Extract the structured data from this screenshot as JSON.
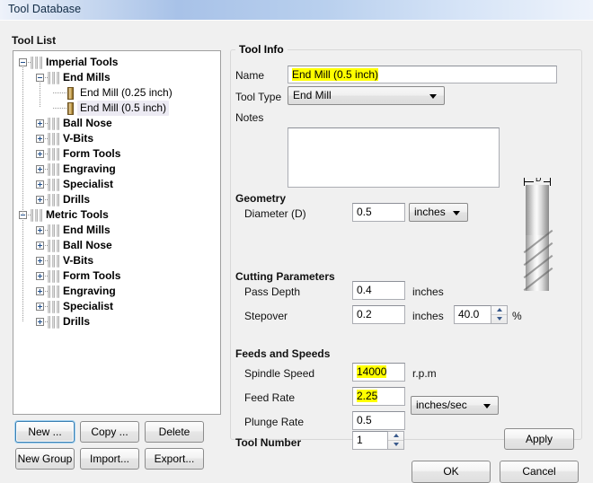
{
  "window": {
    "title": "Tool Database"
  },
  "tool_list": {
    "heading": "Tool List",
    "tree": [
      {
        "label": "Imperial Tools",
        "depth": 0,
        "bold": true,
        "state": "expanded",
        "icon": "tool-group-icon"
      },
      {
        "label": "End Mills",
        "depth": 1,
        "bold": true,
        "state": "expanded",
        "icon": "tool-group-icon"
      },
      {
        "label": "End Mill (0.25 inch)",
        "depth": 2,
        "bold": false,
        "state": "leaf",
        "icon": "end-mill-icon"
      },
      {
        "label": "End Mill (0.5 inch)",
        "depth": 2,
        "bold": false,
        "state": "leaf",
        "icon": "end-mill-icon",
        "selected": true
      },
      {
        "label": "Ball Nose",
        "depth": 1,
        "bold": true,
        "state": "collapsed",
        "icon": "tool-group-icon"
      },
      {
        "label": "V-Bits",
        "depth": 1,
        "bold": true,
        "state": "collapsed",
        "icon": "tool-group-icon"
      },
      {
        "label": "Form Tools",
        "depth": 1,
        "bold": true,
        "state": "collapsed",
        "icon": "tool-group-icon"
      },
      {
        "label": "Engraving",
        "depth": 1,
        "bold": true,
        "state": "collapsed",
        "icon": "tool-group-icon"
      },
      {
        "label": "Specialist",
        "depth": 1,
        "bold": true,
        "state": "collapsed",
        "icon": "tool-group-icon"
      },
      {
        "label": "Drills",
        "depth": 1,
        "bold": true,
        "state": "collapsed",
        "icon": "tool-group-icon"
      },
      {
        "label": "Metric Tools",
        "depth": 0,
        "bold": true,
        "state": "expanded",
        "icon": "tool-group-icon"
      },
      {
        "label": "End Mills",
        "depth": 1,
        "bold": true,
        "state": "collapsed",
        "icon": "tool-group-icon"
      },
      {
        "label": "Ball Nose",
        "depth": 1,
        "bold": true,
        "state": "collapsed",
        "icon": "tool-group-icon"
      },
      {
        "label": "V-Bits",
        "depth": 1,
        "bold": true,
        "state": "collapsed",
        "icon": "tool-group-icon"
      },
      {
        "label": "Form Tools",
        "depth": 1,
        "bold": true,
        "state": "collapsed",
        "icon": "tool-group-icon"
      },
      {
        "label": "Engraving",
        "depth": 1,
        "bold": true,
        "state": "collapsed",
        "icon": "tool-group-icon"
      },
      {
        "label": "Specialist",
        "depth": 1,
        "bold": true,
        "state": "collapsed",
        "icon": "tool-group-icon"
      },
      {
        "label": "Drills",
        "depth": 1,
        "bold": true,
        "state": "collapsed",
        "icon": "tool-group-icon"
      }
    ],
    "buttons": {
      "new": "New ...",
      "copy": "Copy ...",
      "delete": "Delete",
      "new_group": "New Group",
      "import": "Import...",
      "export": "Export..."
    }
  },
  "tool_info": {
    "group_title": "Tool Info",
    "name_label": "Name",
    "name_value": "End Mill (0.5 inch)",
    "tool_type_label": "Tool Type",
    "tool_type_value": "End Mill",
    "notes_label": "Notes",
    "notes_value": "",
    "geometry": {
      "title": "Geometry",
      "diameter_label": "Diameter (D)",
      "diameter_value": "0.5",
      "diameter_units": "inches"
    },
    "cutting": {
      "title": "Cutting Parameters",
      "pass_depth_label": "Pass Depth",
      "pass_depth_value": "0.4",
      "pass_depth_units": "inches",
      "stepover_label": "Stepover",
      "stepover_value": "0.2",
      "stepover_units": "inches",
      "stepover_percent": "40.0",
      "percent_symbol": "%"
    },
    "feeds": {
      "title": "Feeds and Speeds",
      "spindle_label": "Spindle Speed",
      "spindle_value": "14000",
      "spindle_units": "r.p.m",
      "feed_rate_label": "Feed Rate",
      "feed_rate_value": "2.25",
      "plunge_rate_label": "Plunge Rate",
      "plunge_rate_value": "0.5",
      "rate_units": "inches/sec"
    },
    "tool_number_label": "Tool Number",
    "tool_number_value": "1",
    "apply_label": "Apply",
    "preview_dim_label": "D"
  },
  "dialog_buttons": {
    "ok": "OK",
    "cancel": "Cancel"
  },
  "highlights": {
    "marker_color": "#ffff00"
  }
}
